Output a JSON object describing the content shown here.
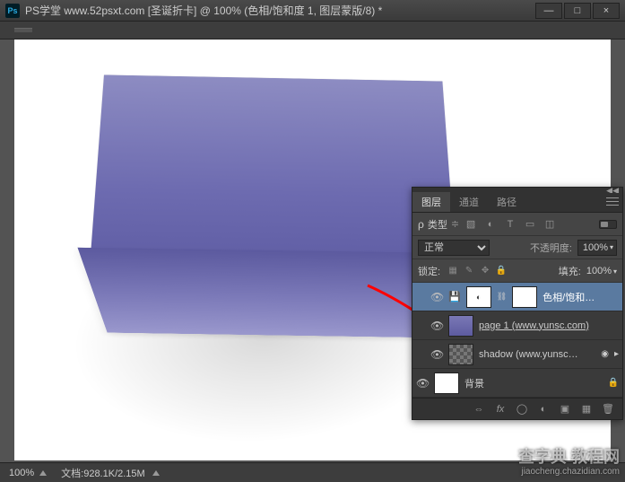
{
  "window": {
    "app_icon_text": "Ps",
    "title": "PS学堂 www.52psxt.com [圣诞折卡] @ 100% (色相/饱和度 1, 图层蒙版/8) *"
  },
  "document": {
    "tab_label": ""
  },
  "status": {
    "zoom": "100%",
    "file_info_label": "文档:",
    "file_info_value": "928.1K/2.15M"
  },
  "panel": {
    "tabs": [
      "图层",
      "通道",
      "路径"
    ],
    "filter": {
      "kind_label": "类型",
      "icons": [
        "img-icon",
        "adjust-icon",
        "type-icon",
        "shape-icon",
        "smart-icon"
      ]
    },
    "blend": {
      "mode": "正常",
      "opacity_label": "不透明度:",
      "opacity_value": "100%"
    },
    "lock": {
      "label": "锁定:",
      "fill_label": "填充:",
      "fill_value": "100%"
    },
    "layers": [
      {
        "visible": true,
        "name": "色相/饱和…",
        "selected": true,
        "kind": "adjustment",
        "has_mask": true,
        "sub": true
      },
      {
        "visible": true,
        "name": "page 1 (www.yunsc.com)",
        "kind": "smart",
        "underline": true,
        "sub": true
      },
      {
        "visible": true,
        "name": "shadow (www.yunsc…",
        "kind": "smart",
        "sub": true,
        "disclosure": true
      },
      {
        "visible": true,
        "name": "背景",
        "kind": "white",
        "locked": true
      }
    ],
    "footer_icons": [
      "link-icon",
      "fx-icon",
      "mask-icon",
      "adjustment-icon",
      "group-icon",
      "new-icon",
      "trash-icon"
    ]
  },
  "watermark": {
    "main": "查字典 教程网",
    "sub": "jiaocheng.chazidian.com"
  }
}
